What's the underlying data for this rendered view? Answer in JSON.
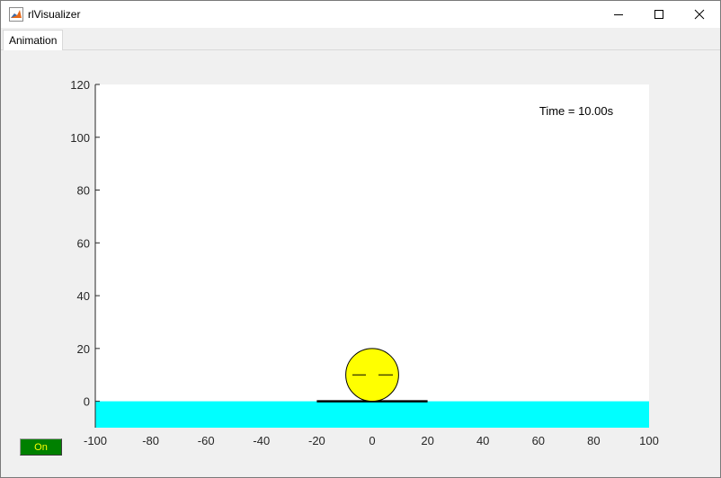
{
  "window": {
    "title": "rlVisualizer",
    "minimize_icon": "minimize-icon",
    "maximize_icon": "maximize-icon",
    "close_icon": "close-icon",
    "app_icon": "matlab-icon"
  },
  "tabs": [
    {
      "label": "Animation"
    }
  ],
  "plot": {
    "time_text": "Time = 10.00s",
    "xlim": [
      -100,
      100
    ],
    "ylim": [
      -10,
      120
    ],
    "x_ticks": [
      -100,
      -80,
      -60,
      -40,
      -20,
      0,
      20,
      40,
      60,
      80,
      100
    ],
    "y_ticks": [
      0,
      20,
      40,
      60,
      80,
      100,
      120
    ],
    "ground_color": "#00ffff",
    "ball_color": "#ffff00",
    "platform": {
      "x_from": -20,
      "x_to": 20,
      "y": 0
    },
    "ball": {
      "x": 0,
      "y": 10,
      "radius": 10
    },
    "ground": {
      "y_from": -10,
      "y_to": 0
    }
  },
  "toggle": {
    "label": "On",
    "color": "#008000",
    "text_color": "#ffff00"
  }
}
